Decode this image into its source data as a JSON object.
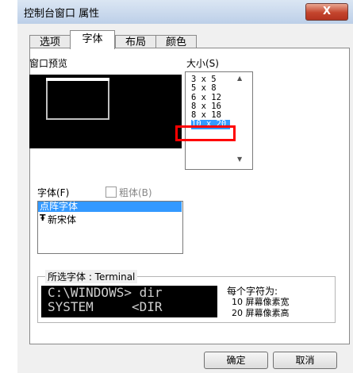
{
  "window": {
    "title": "控制台窗口 属性",
    "close_label": "X"
  },
  "tabs": [
    {
      "label": "选项",
      "active": false
    },
    {
      "label": "字体",
      "active": true
    },
    {
      "label": "布局",
      "active": false
    },
    {
      "label": "颜色",
      "active": false
    }
  ],
  "preview": {
    "label": "窗口预览"
  },
  "size": {
    "label": "大小(S)",
    "items": [
      "3 x 5",
      "5 x 8",
      "6 x 12",
      "8 x 16",
      "8 x 18",
      "10 x 20"
    ],
    "selected": "10 x 20"
  },
  "font": {
    "label": "字体(F)",
    "bold_label": "粗体(B)",
    "bold_checked": false,
    "items": [
      "点阵字体",
      "新宋体"
    ],
    "selected": "点阵字体",
    "truetype_icon": "Ŧ"
  },
  "selected_font": {
    "title": "所选字体 : Terminal",
    "sample_line1": "C:\\WINDOWS> dir",
    "sample_line2": "SYSTEM     <DIR",
    "info_label": "每个字符为:",
    "width_info": "10 屏幕像素宽",
    "height_info": "20 屏幕像素高"
  },
  "buttons": {
    "ok": "确定",
    "cancel": "取消"
  },
  "colors": {
    "selection": "#3399ff",
    "highlight_box": "#ff0000",
    "close_button": "#c4452d"
  }
}
